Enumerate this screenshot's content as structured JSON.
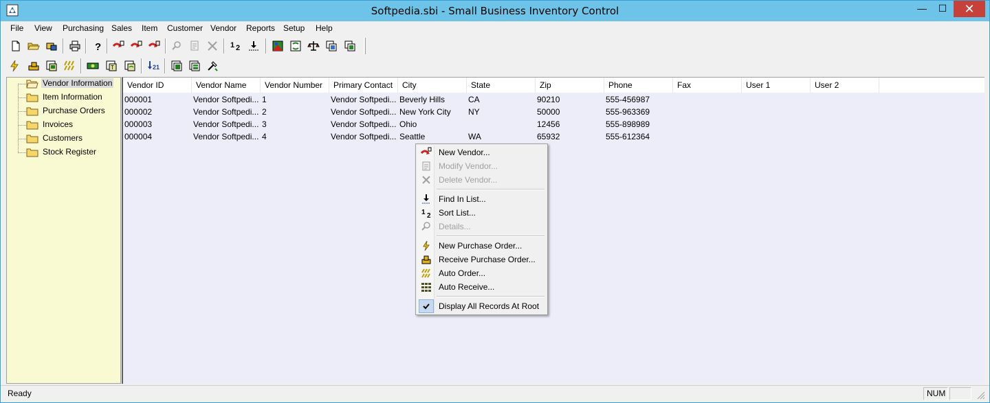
{
  "window": {
    "title": "Softpedia.sbi - Small Business Inventory Control",
    "minimize": "—",
    "maximize": "☐",
    "close": "✕"
  },
  "menu": [
    "File",
    "View",
    "Purchasing",
    "Sales",
    "Item",
    "Customer",
    "Vendor",
    "Reports",
    "Setup",
    "Help"
  ],
  "toolbar1": [
    "new-document-icon",
    "open-folder-icon",
    "open-file-icon",
    "print-icon",
    "help-icon",
    "new-vendor-icon",
    "modify-vendor-icon",
    "delete-vendor-icon",
    "details-icon",
    "modify-icon",
    "delete-icon",
    "sort-list-icon",
    "find-in-list-icon",
    "report-icon",
    "recycle-icon",
    "scale-icon",
    "copy-icon",
    "copy-alt-icon"
  ],
  "toolbar2": [
    "new-purchase-order-icon",
    "receive-purchase-order-icon",
    "purchase-report-icon",
    "auto-order-icon",
    "auto-receive-icon",
    "invoice-icon",
    "invoice-alt-icon",
    "reorder-icon",
    "stack-icon",
    "stack-alt-icon",
    "tools-icon"
  ],
  "tree": {
    "items": [
      "Vendor Information",
      "Item Information",
      "Purchase Orders",
      "Invoices",
      "Customers",
      "Stock Register"
    ],
    "selected": "Vendor Information"
  },
  "list": {
    "columns": [
      "Vendor ID",
      "Vendor Name",
      "Vendor Number",
      "Primary Contact",
      "City",
      "State",
      "Zip",
      "Phone",
      "Fax",
      "User 1",
      "User 2"
    ],
    "rows": [
      [
        "000001",
        "Vendor Softpedi...",
        "1",
        "Vendor Softpedi...",
        "Beverly Hills",
        "CA",
        "90210",
        "555-456987",
        "",
        "",
        ""
      ],
      [
        "000002",
        "Vendor Softpedi...",
        "2",
        "Vendor Softpedi...",
        "New York City",
        "NY",
        "50000",
        "555-963369",
        "",
        "",
        ""
      ],
      [
        "000003",
        "Vendor Softpedi...",
        "3",
        "Vendor Softpedi...",
        "Ohio",
        "",
        "12456",
        "555-898989",
        "",
        "",
        ""
      ],
      [
        "000004",
        "Vendor Softpedi...",
        "4",
        "Vendor Softpedi...",
        "Seattle",
        "WA",
        "65932",
        "555-612364",
        "",
        "",
        ""
      ]
    ]
  },
  "context_menu": {
    "items": [
      {
        "label": "New Vendor...",
        "icon": "new-vendor-icon",
        "enabled": true
      },
      {
        "label": "Modify Vendor...",
        "icon": "modify-vendor-icon",
        "enabled": false
      },
      {
        "label": "Delete Vendor...",
        "icon": "delete-icon",
        "enabled": false
      },
      {
        "label": "Find In List...",
        "icon": "find-in-list-icon",
        "enabled": true
      },
      {
        "label": "Sort List...",
        "icon": "sort-list-icon",
        "enabled": true
      },
      {
        "label": "Details...",
        "icon": "details-icon",
        "enabled": false
      },
      {
        "label": "New Purchase Order...",
        "icon": "new-purchase-order-icon",
        "enabled": true
      },
      {
        "label": "Receive Purchase Order...",
        "icon": "receive-purchase-order-icon",
        "enabled": true
      },
      {
        "label": "Auto Order...",
        "icon": "auto-order-icon",
        "enabled": true
      },
      {
        "label": "Auto Receive...",
        "icon": "auto-receive-icon",
        "enabled": true
      },
      {
        "label": "Display All Records At Root",
        "icon": "check-icon",
        "enabled": true,
        "checked": true
      }
    ]
  },
  "status": {
    "text": "Ready",
    "num": "NUM"
  },
  "colors": {
    "titlebar": "#6ec4e8",
    "tree_bg": "#fafad2",
    "list_bg": "#ecedf9",
    "close": "#c7413b"
  }
}
